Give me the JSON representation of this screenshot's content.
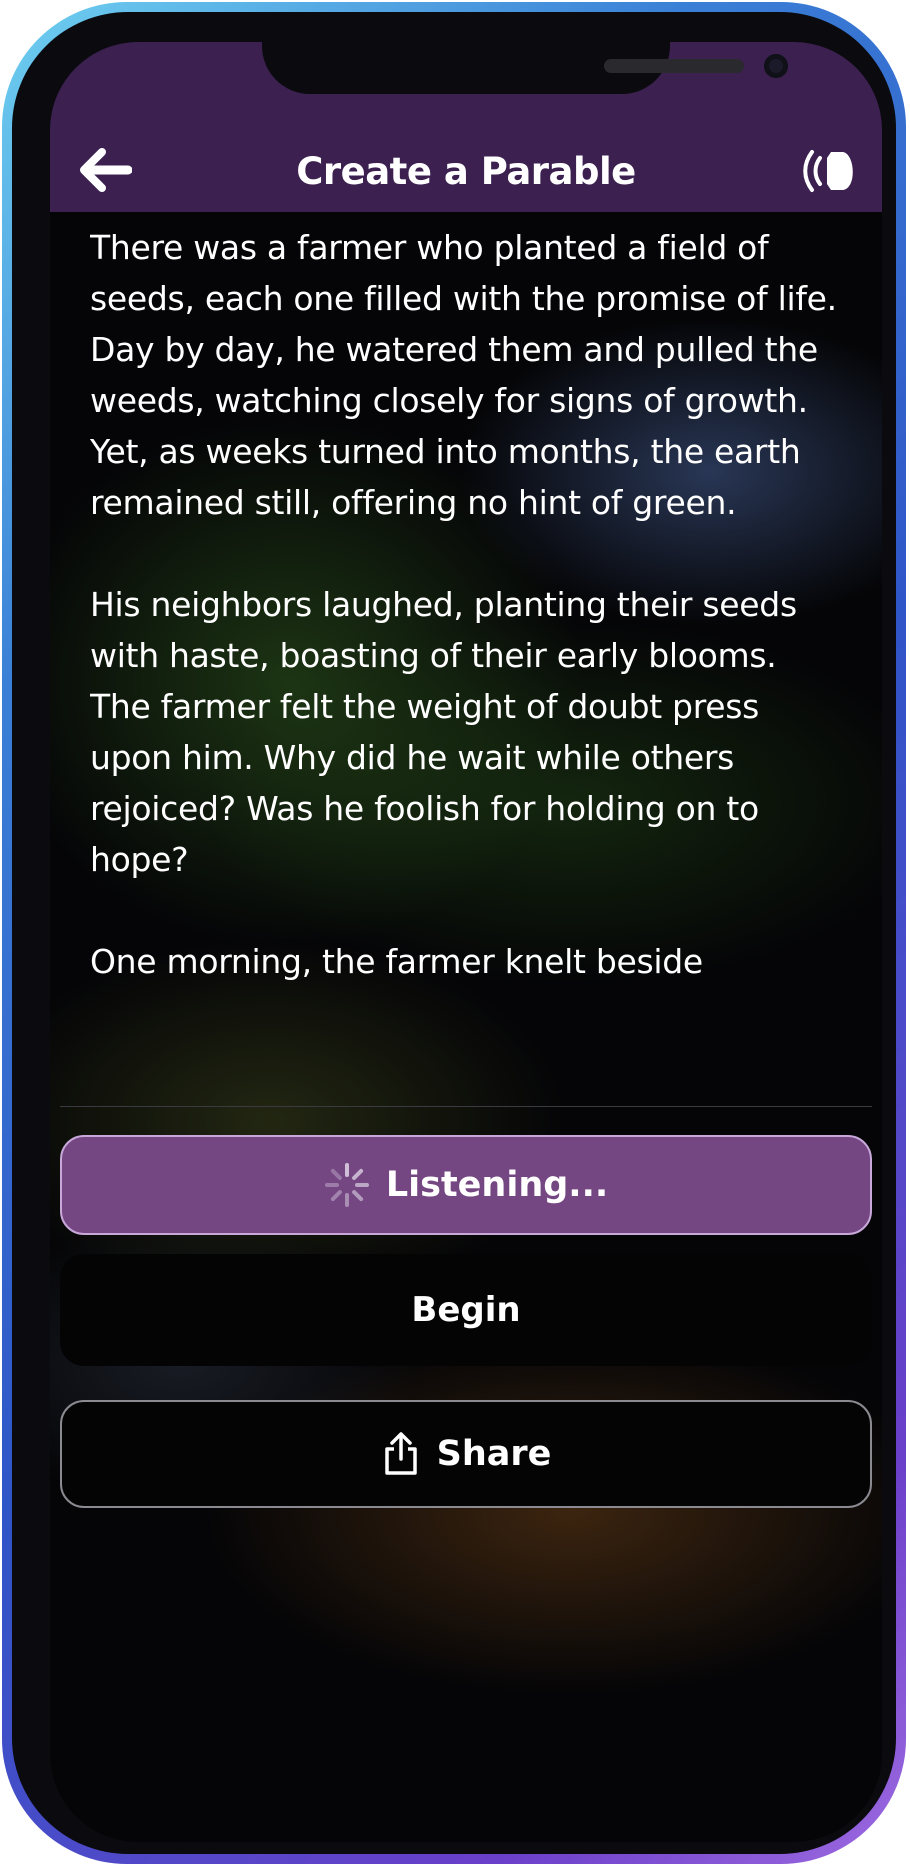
{
  "header": {
    "title": "Create a Parable",
    "back_icon": "arrow-left-icon",
    "sound_icon": "speaker-sound-icon",
    "background": "#3b2050"
  },
  "story": {
    "paragraphs": [
      "There was a farmer who planted a field of seeds, each one filled with the promise of life. Day by day, he watered them and pulled the weeds, watching closely for signs of growth. Yet, as weeks turned into months, the earth remained still, offering no hint of green.",
      "His neighbors laughed, planting their seeds with haste, boasting of their early blooms. The farmer felt the weight of doubt press upon him. Why did he wait while others rejoiced? Was he foolish for holding on to hope?",
      "One morning, the farmer knelt beside"
    ]
  },
  "actions": {
    "listening_label": "Listening...",
    "listening_icon": "loading-spinner-icon",
    "begin_label": "Begin",
    "share_label": "Share",
    "share_icon": "share-icon"
  },
  "colors": {
    "accent": "#744682",
    "accent_border": "#c7a8d8",
    "text": "#ffffff"
  }
}
